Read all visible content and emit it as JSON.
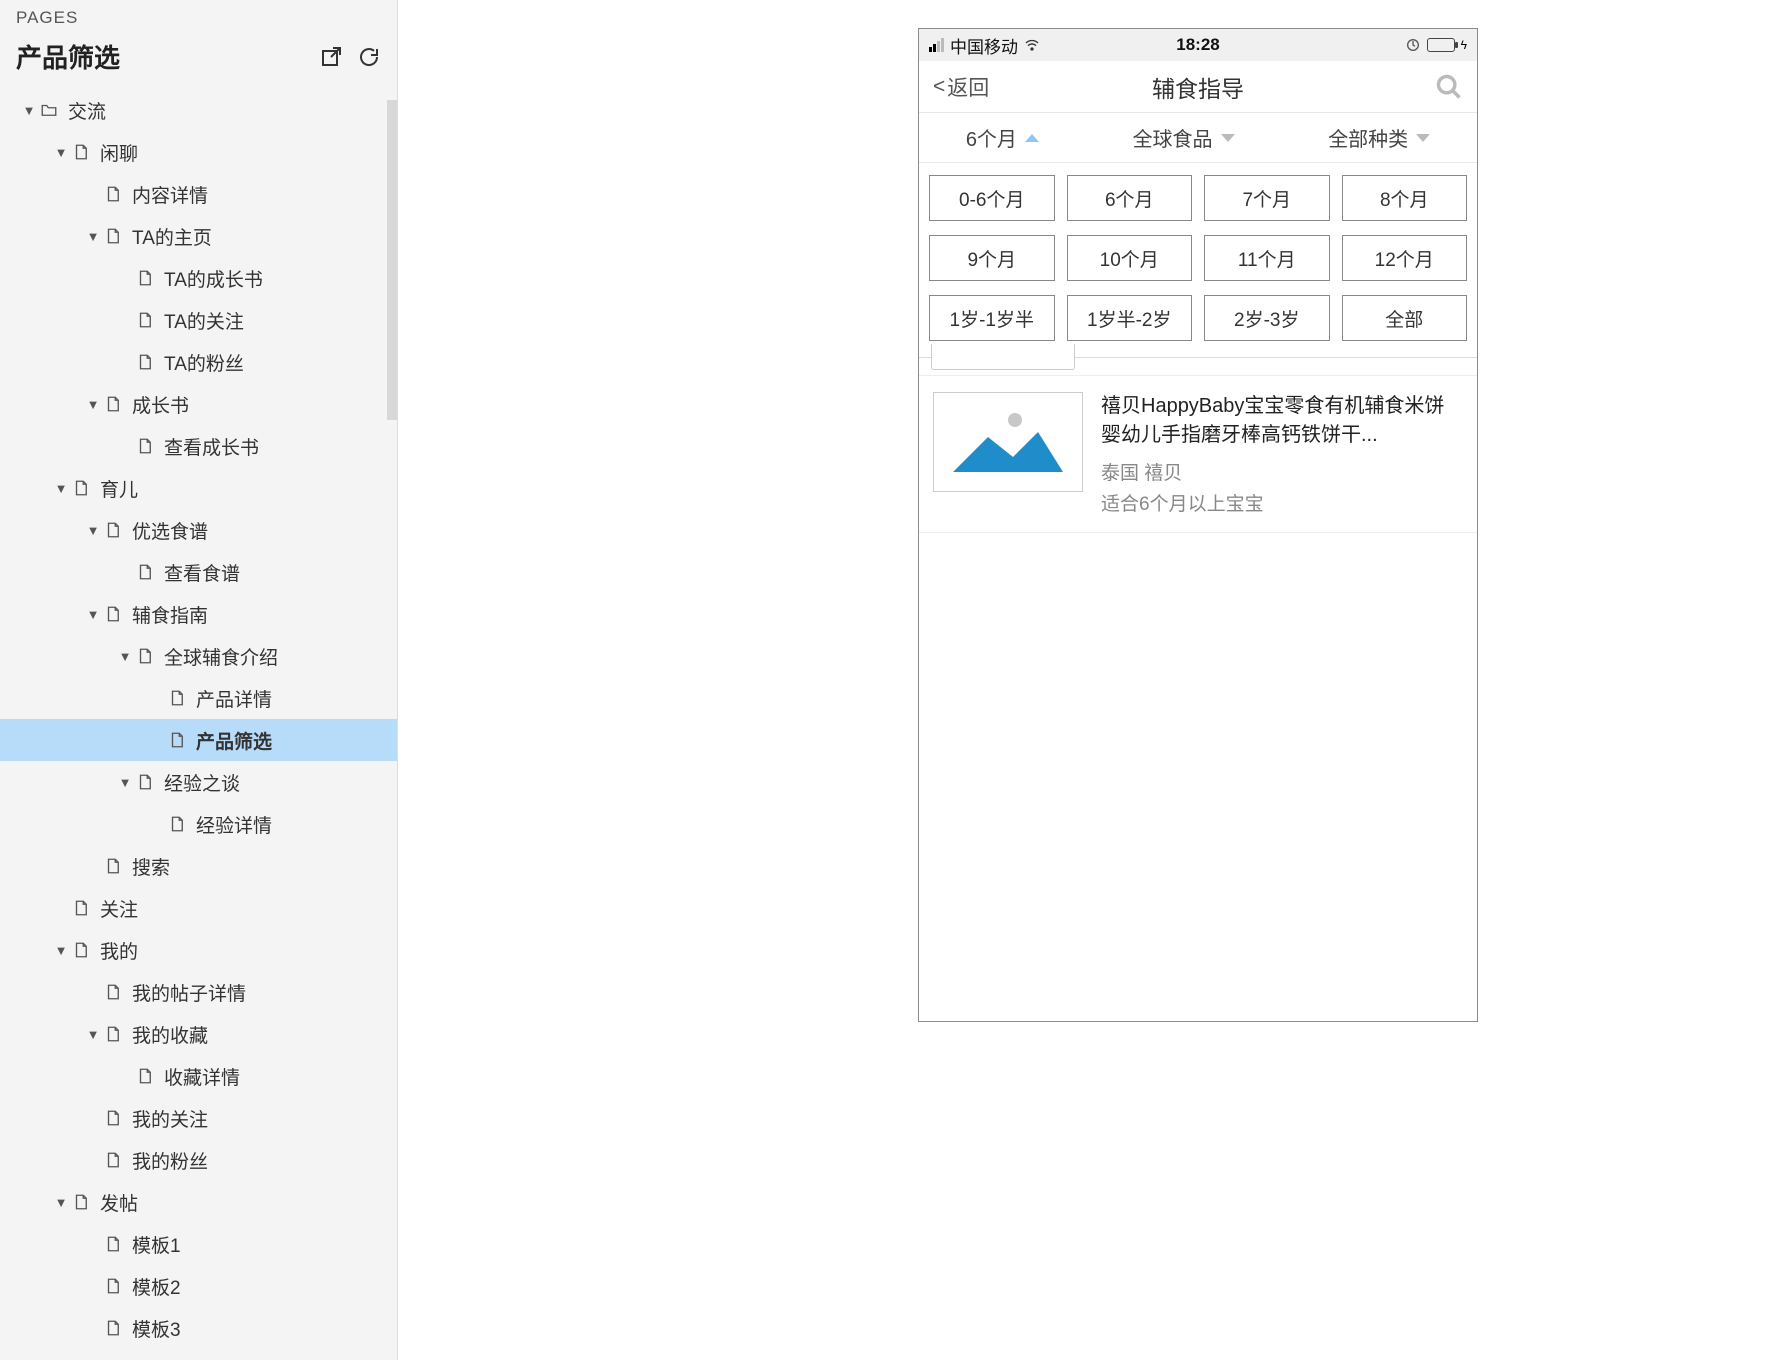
{
  "sidebar": {
    "pages_label": "PAGES",
    "current_page": "产品筛选",
    "tree": [
      {
        "label": "交流",
        "depth": 0,
        "type": "folder",
        "caret": true
      },
      {
        "label": "闲聊",
        "depth": 1,
        "type": "page",
        "caret": true
      },
      {
        "label": "内容详情",
        "depth": 2,
        "type": "page",
        "caret": false
      },
      {
        "label": "TA的主页",
        "depth": 2,
        "type": "page",
        "caret": true
      },
      {
        "label": "TA的成长书",
        "depth": 3,
        "type": "page",
        "caret": false
      },
      {
        "label": "TA的关注",
        "depth": 3,
        "type": "page",
        "caret": false
      },
      {
        "label": "TA的粉丝",
        "depth": 3,
        "type": "page",
        "caret": false
      },
      {
        "label": "成长书",
        "depth": 2,
        "type": "page",
        "caret": true
      },
      {
        "label": "查看成长书",
        "depth": 3,
        "type": "page",
        "caret": false
      },
      {
        "label": "育儿",
        "depth": 1,
        "type": "page",
        "caret": true
      },
      {
        "label": "优选食谱",
        "depth": 2,
        "type": "page",
        "caret": true
      },
      {
        "label": "查看食谱",
        "depth": 3,
        "type": "page",
        "caret": false
      },
      {
        "label": "辅食指南",
        "depth": 2,
        "type": "page",
        "caret": true
      },
      {
        "label": "全球辅食介绍",
        "depth": 3,
        "type": "page",
        "caret": true
      },
      {
        "label": "产品详情",
        "depth": 4,
        "type": "page",
        "caret": false
      },
      {
        "label": "产品筛选",
        "depth": 4,
        "type": "page",
        "caret": false,
        "selected": true
      },
      {
        "label": "经验之谈",
        "depth": 3,
        "type": "page",
        "caret": true
      },
      {
        "label": "经验详情",
        "depth": 4,
        "type": "page",
        "caret": false
      },
      {
        "label": "搜索",
        "depth": 2,
        "type": "page",
        "caret": false
      },
      {
        "label": "关注",
        "depth": 1,
        "type": "page",
        "caret": false
      },
      {
        "label": "我的",
        "depth": 1,
        "type": "page",
        "caret": true
      },
      {
        "label": "我的帖子详情",
        "depth": 2,
        "type": "page",
        "caret": false
      },
      {
        "label": "我的收藏",
        "depth": 2,
        "type": "page",
        "caret": true
      },
      {
        "label": "收藏详情",
        "depth": 3,
        "type": "page",
        "caret": false
      },
      {
        "label": "我的关注",
        "depth": 2,
        "type": "page",
        "caret": false
      },
      {
        "label": "我的粉丝",
        "depth": 2,
        "type": "page",
        "caret": false
      },
      {
        "label": "发帖",
        "depth": 1,
        "type": "page",
        "caret": true
      },
      {
        "label": "模板1",
        "depth": 2,
        "type": "page",
        "caret": false
      },
      {
        "label": "模板2",
        "depth": 2,
        "type": "page",
        "caret": false
      },
      {
        "label": "模板3",
        "depth": 2,
        "type": "page",
        "caret": false
      }
    ]
  },
  "phone": {
    "status": {
      "carrier": "中国移动",
      "time": "18:28"
    },
    "nav": {
      "back": "返回",
      "title": "辅食指导"
    },
    "filters": [
      {
        "label": "6个月",
        "dir": "up"
      },
      {
        "label": "全球食品",
        "dir": "down"
      },
      {
        "label": "全部种类",
        "dir": "down"
      }
    ],
    "options": [
      "0-6个月",
      "6个月",
      "7个月",
      "8个月",
      "9个月",
      "10个月",
      "11个月",
      "12个月",
      "1岁-1岁半",
      "1岁半-2岁",
      "2岁-3岁",
      "全部"
    ],
    "card": {
      "title": "禧贝HappyBaby宝宝零食有机辅食米饼婴幼儿手指磨牙棒高钙铁饼干...",
      "sub": "泰国 禧贝",
      "fit": "适合6个月以上宝宝"
    }
  }
}
